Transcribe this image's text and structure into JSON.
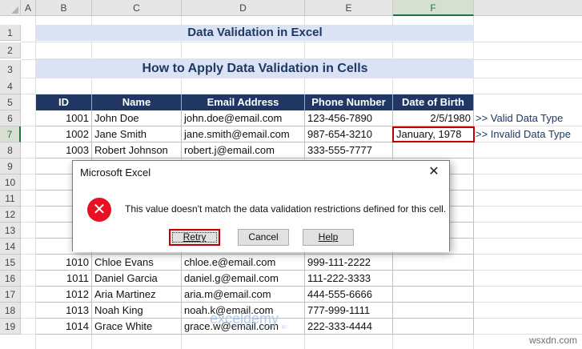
{
  "columns": [
    "A",
    "B",
    "C",
    "D",
    "E",
    "F"
  ],
  "rows": [
    "1",
    "2",
    "3",
    "4",
    "5",
    "6",
    "7",
    "8",
    "9",
    "10",
    "11",
    "12",
    "13",
    "14",
    "15",
    "16",
    "17",
    "18",
    "19"
  ],
  "title": "Data Validation in Excel",
  "subtitle": "How to Apply Data Validation in Cells",
  "table": {
    "headers": [
      "ID",
      "Name",
      "Email Address",
      "Phone Number",
      "Date of Birth"
    ],
    "rows": [
      {
        "id": "1001",
        "name": "John Doe",
        "email": "john.doe@email.com",
        "phone": "123-456-7890",
        "dob": "2/5/1980"
      },
      {
        "id": "1002",
        "name": "Jane Smith",
        "email": "jane.smith@email.com",
        "phone": "987-654-3210",
        "dob": "January, 1978"
      },
      {
        "id": "1003",
        "name": "Robert Johnson",
        "email": "robert.j@email.com",
        "phone": "333-555-7777",
        "dob": ""
      },
      {
        "id": "1010",
        "name": "Chloe Evans",
        "email": "chloe.e@email.com",
        "phone": "999-111-2222",
        "dob": ""
      },
      {
        "id": "1011",
        "name": "Daniel Garcia",
        "email": "daniel.g@email.com",
        "phone": "111-222-3333",
        "dob": ""
      },
      {
        "id": "1012",
        "name": "Aria Martinez",
        "email": "aria.m@email.com",
        "phone": "444-555-6666",
        "dob": ""
      },
      {
        "id": "1013",
        "name": "Noah King",
        "email": "noah.k@email.com",
        "phone": "777-999-1111",
        "dob": ""
      },
      {
        "id": "1014",
        "name": "Grace White",
        "email": "grace.w@email.com",
        "phone": "222-333-4444",
        "dob": ""
      }
    ]
  },
  "notes": {
    "valid": ">> Valid Data Type",
    "invalid": ">> Invalid Data Type"
  },
  "dialog": {
    "title": "Microsoft Excel",
    "close": "✕",
    "message": "This value doesn't match the data validation restrictions defined for this cell.",
    "retry": "Retry",
    "cancel": "Cancel",
    "help": "Help",
    "icon": "error-x-icon"
  },
  "watermark": "exceldemy",
  "watermark_tag": "EXCEL · DATA · BI",
  "site": "wsxdn.com"
}
